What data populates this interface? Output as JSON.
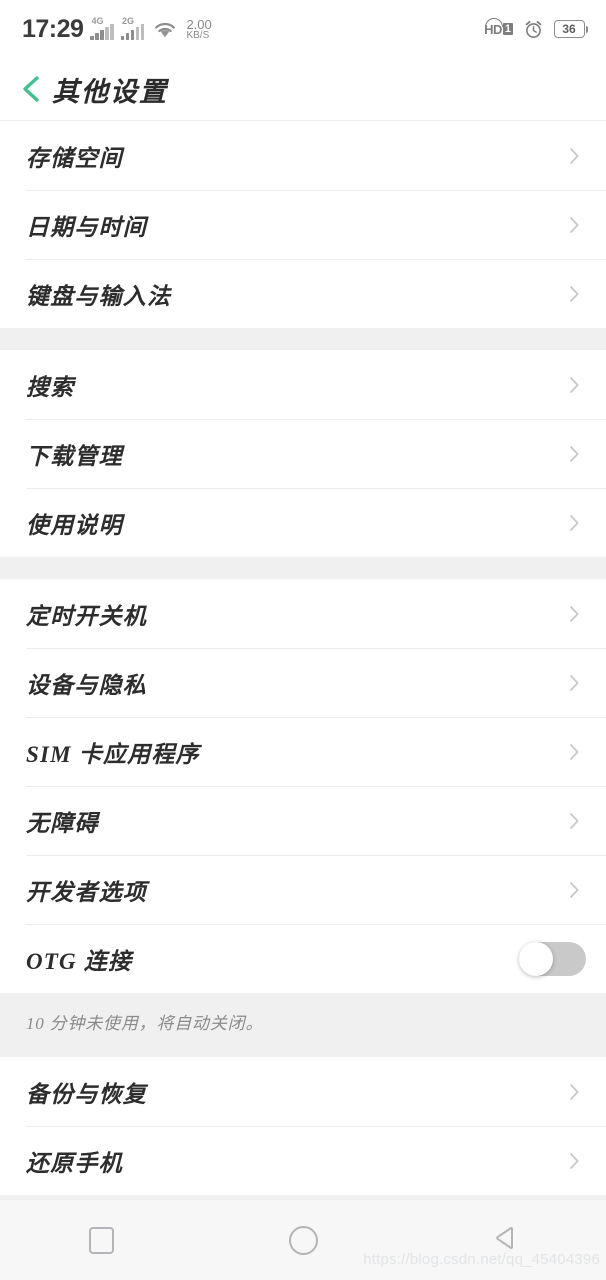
{
  "status_bar": {
    "time": "17:29",
    "network_1_label": "4G",
    "network_2_label": "2G",
    "wifi_icon": "wifi-icon",
    "speed_value": "2.00",
    "speed_unit": "KB/S",
    "volte_label": "HD",
    "volte_sim": "1",
    "alarm_icon": "alarm-clock-icon",
    "battery_percent": "36"
  },
  "header": {
    "back_icon": "back-chevron-icon",
    "title": "其他设置"
  },
  "list": {
    "groups": [
      {
        "items": [
          {
            "label": "存储空间",
            "type": "link"
          },
          {
            "label": "日期与时间",
            "type": "link"
          },
          {
            "label": "键盘与输入法",
            "type": "link"
          }
        ]
      },
      {
        "items": [
          {
            "label": "搜索",
            "type": "link"
          },
          {
            "label": "下载管理",
            "type": "link"
          },
          {
            "label": "使用说明",
            "type": "link"
          }
        ]
      },
      {
        "items": [
          {
            "label": "定时开关机",
            "type": "link"
          },
          {
            "label": "设备与隐私",
            "type": "link"
          },
          {
            "label": "SIM 卡应用程序",
            "type": "link"
          },
          {
            "label": "无障碍",
            "type": "link"
          },
          {
            "label": "开发者选项",
            "type": "link"
          },
          {
            "label": "OTG 连接",
            "type": "toggle",
            "value": "off"
          }
        ],
        "footer_note": "10 分钟未使用，将自动关闭。"
      },
      {
        "items": [
          {
            "label": "备份与恢复",
            "type": "link"
          },
          {
            "label": "还原手机",
            "type": "link"
          }
        ]
      }
    ]
  },
  "nav_bar": {
    "recents_icon": "square-recents-icon",
    "home_icon": "circle-home-icon",
    "back_icon": "triangle-back-icon"
  },
  "watermark": "https://blog.csdn.net/qq_45404396"
}
